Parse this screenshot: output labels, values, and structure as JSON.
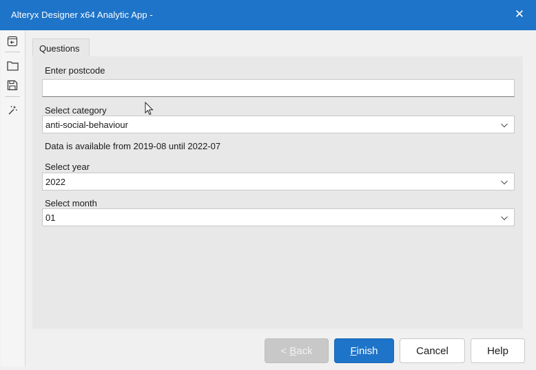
{
  "window": {
    "title": "Alteryx Designer x64 Analytic App -",
    "close_glyph": "✕"
  },
  "toolbar": {
    "icons": [
      "collapse-panel-icon",
      "open-folder-icon",
      "save-icon",
      "magic-wand-icon"
    ]
  },
  "tabs": [
    {
      "label": "Questions",
      "active": true
    }
  ],
  "form": {
    "postcode": {
      "label": "Enter postcode",
      "value": "",
      "placeholder": ""
    },
    "category": {
      "label": "Select category",
      "value": "anti-social-behaviour"
    },
    "availability_note": "Data is available from 2019-08 until 2022-07",
    "year": {
      "label": "Select year",
      "value": "2022"
    },
    "month": {
      "label": "Select month",
      "value": "01"
    }
  },
  "footer": {
    "back": {
      "prefix": "< ",
      "accel": "B",
      "rest": "ack",
      "enabled": false
    },
    "finish": {
      "accel": "F",
      "rest": "inish"
    },
    "cancel": "Cancel",
    "help": "Help"
  },
  "colors": {
    "title_bar": "#1e74c8",
    "primary_button": "#1e74c8",
    "disabled_button": "#c8c8c8",
    "panel": "#e8e8e8"
  }
}
